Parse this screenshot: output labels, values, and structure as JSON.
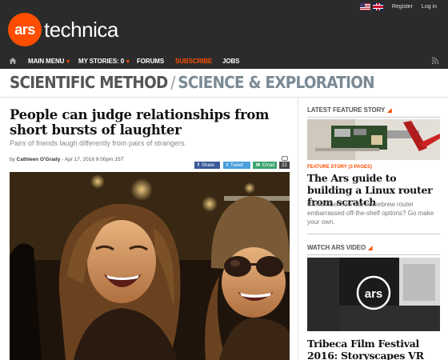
{
  "header": {
    "login_links": {
      "register": "Register",
      "login": "Log in"
    },
    "brand": {
      "badge": "ars",
      "word": "technica",
      "accent_color": "#ff4e00"
    },
    "nav": {
      "main_menu": "MAIN MENU",
      "my_stories": "MY STORIES: 0",
      "forums": "FORUMS",
      "subscribe": "SUBSCRIBE",
      "jobs": "JOBS"
    }
  },
  "section": {
    "primary": "SCIENTIFIC METHOD",
    "separator": "/",
    "secondary": "SCIENCE & EXPLORATION"
  },
  "article": {
    "headline": "People can judge relationships from short bursts of laughter",
    "subhead": "Pairs of friends laugh differently from pairs of strangers.",
    "byline_prefix": "by ",
    "author": "Cathleen O'Grady",
    "date": " - Apr 17, 2016 9:00pm JST",
    "share": {
      "facebook": "Share",
      "twitter": "Tweet",
      "email": "Email"
    },
    "comment_count": "22",
    "photo_icon": "laughing-women-photo"
  },
  "sidebar": {
    "feature_heading": "LATEST FEATURE STORY",
    "feature_label": "FEATURE STORY (3 PAGES)",
    "feature_title": "The Ars guide to building a Linux router from scratch",
    "feature_desc": "Remember how our homebrew router embarrassed off-the-shelf options? Go make your own.",
    "video_heading": "WATCH ARS VIDEO",
    "video_badge": "ars",
    "video_title": "Tribeca Film Festival 2016: Storyscapes VR"
  }
}
